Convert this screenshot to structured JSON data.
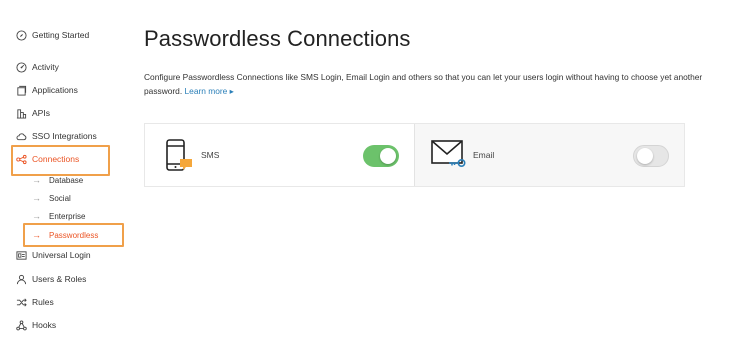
{
  "sidebar": {
    "items": [
      {
        "label": "Getting Started",
        "icon": "compass-icon"
      },
      {
        "label": "Activity",
        "icon": "activity-icon"
      },
      {
        "label": "Applications",
        "icon": "applications-icon"
      },
      {
        "label": "APIs",
        "icon": "apis-icon"
      },
      {
        "label": "SSO Integrations",
        "icon": "cloud-icon"
      },
      {
        "label": "Connections",
        "icon": "connections-icon",
        "active": true
      },
      {
        "label": "Universal Login",
        "icon": "universal-login-icon"
      },
      {
        "label": "Users & Roles",
        "icon": "users-icon"
      },
      {
        "label": "Rules",
        "icon": "rules-icon"
      },
      {
        "label": "Hooks",
        "icon": "hooks-icon"
      }
    ],
    "sub_items": [
      {
        "label": "Database"
      },
      {
        "label": "Social"
      },
      {
        "label": "Enterprise"
      },
      {
        "label": "Passwordless",
        "active": true
      }
    ]
  },
  "main": {
    "title": "Passwordless Connections",
    "description": "Configure Passwordless Connections like SMS Login, Email Login and others so that you can let your users login without having to choose yet another password.",
    "learn_more": "Learn more ▸",
    "connections": [
      {
        "label": "SMS",
        "icon": "phone-message-icon",
        "enabled": true
      },
      {
        "label": "Email",
        "icon": "envelope-key-icon",
        "enabled": false
      }
    ]
  },
  "colors": {
    "accent": "#eb5424",
    "highlight_box": "#f0a04a",
    "toggle_on": "#6cc26b",
    "link": "#2a7fb8"
  }
}
